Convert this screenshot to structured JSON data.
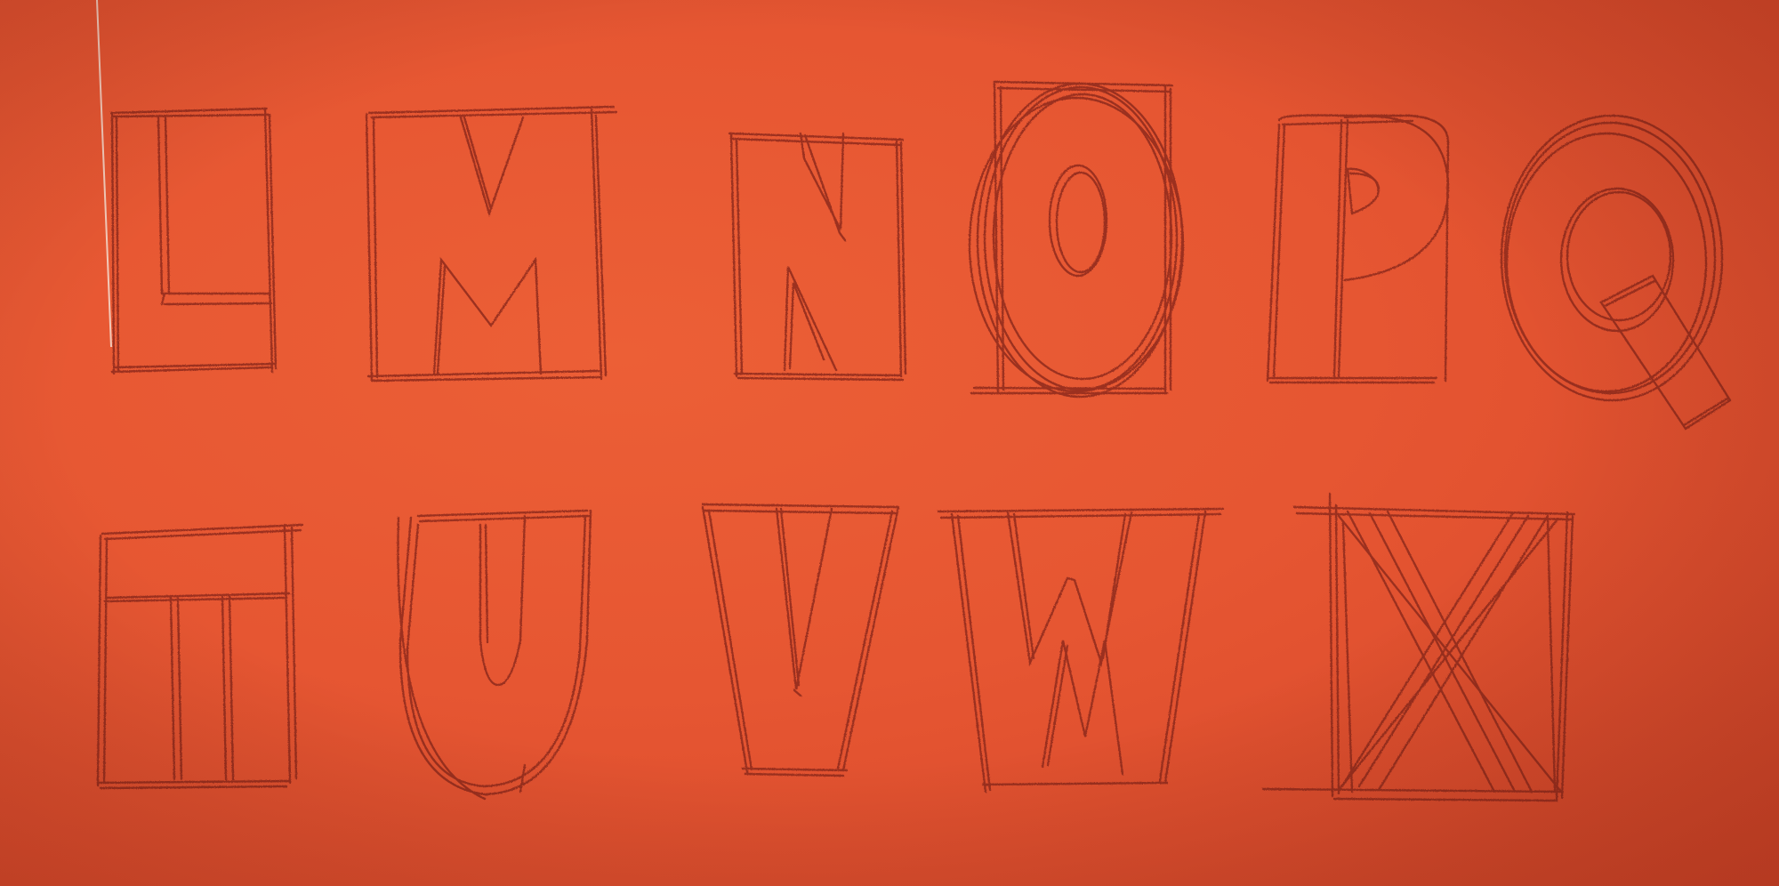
{
  "photo": {
    "paper_color": "#e65632",
    "pencil_color": "#8f2c1c",
    "highlight_color": "#f5ddd0"
  },
  "rows": [
    {
      "letters": [
        {
          "glyph": "L",
          "style": "block-in-box"
        },
        {
          "glyph": "M",
          "style": "inverted-v-over-m"
        },
        {
          "glyph": "N",
          "style": "split-diagonal"
        },
        {
          "glyph": "O",
          "style": "oval-in-box"
        },
        {
          "glyph": "P",
          "style": "bowl-in-rounded-box"
        },
        {
          "glyph": "Q",
          "style": "ring-with-tail"
        }
      ]
    },
    {
      "letters": [
        {
          "glyph": "T",
          "style": "block-in-box"
        },
        {
          "glyph": "U",
          "style": "u-in-rounded-shield"
        },
        {
          "glyph": "V",
          "style": "v-in-trapezoid"
        },
        {
          "glyph": "W",
          "style": "w-in-trapezoid"
        },
        {
          "glyph": "X",
          "style": "crossed-in-box"
        }
      ]
    }
  ]
}
